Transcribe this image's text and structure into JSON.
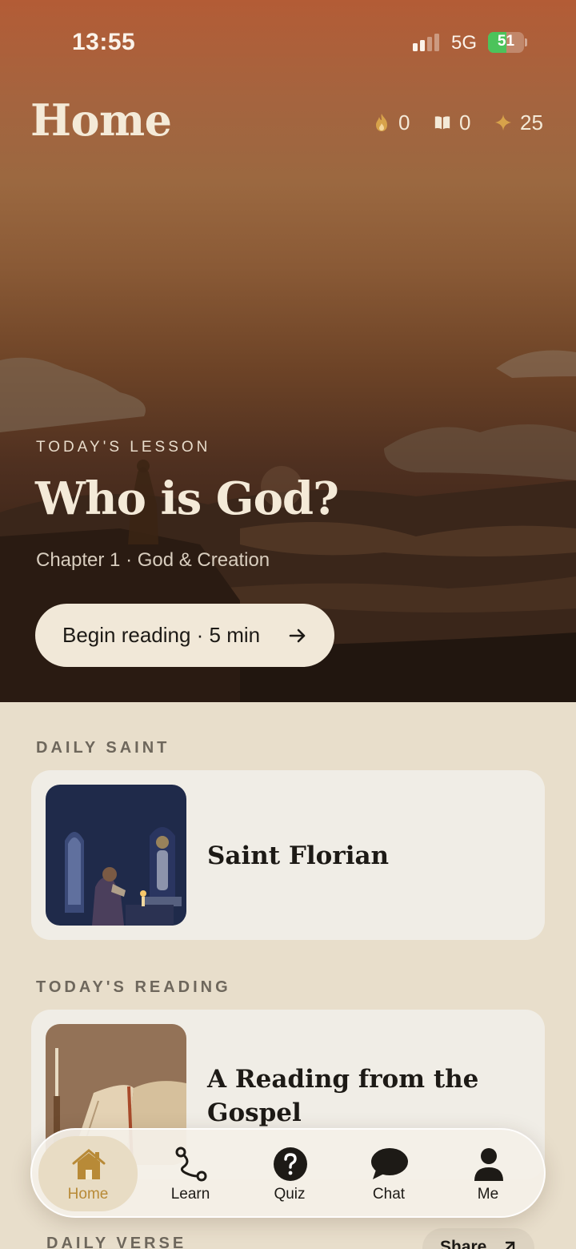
{
  "status_bar": {
    "time": "13:55",
    "network": "5G",
    "battery": "51",
    "battery_level": 0.51
  },
  "header": {
    "title": "Home",
    "stats": [
      {
        "icon": "flame-icon",
        "value": "0"
      },
      {
        "icon": "book-icon",
        "value": "0"
      },
      {
        "icon": "sparkle-icon",
        "value": "25"
      }
    ]
  },
  "lesson": {
    "eyebrow": "TODAY'S LESSON",
    "title": "Who is God?",
    "subtitle": "Chapter 1 · God & Creation",
    "cta": "Begin reading · 5 min"
  },
  "daily_saint": {
    "label": "DAILY SAINT",
    "name": "Saint Florian"
  },
  "todays_reading": {
    "label": "TODAY'S READING",
    "title_line1": "A Reading from the",
    "title_line2": "Gospel"
  },
  "daily_verse": {
    "label": "DAILY VERSE",
    "share": "Share"
  },
  "nav": {
    "tabs": [
      {
        "label": "Home",
        "icon": "home-icon",
        "active": true
      },
      {
        "label": "Learn",
        "icon": "path-icon"
      },
      {
        "label": "Quiz",
        "icon": "question-icon"
      },
      {
        "label": "Chat",
        "icon": "chat-bubble-icon"
      },
      {
        "label": "Me",
        "icon": "person-icon"
      }
    ]
  },
  "colors": {
    "accent": "#b88a37",
    "background": "#e8decb",
    "card": "#f0ede6",
    "battery": "#4cc35b"
  }
}
